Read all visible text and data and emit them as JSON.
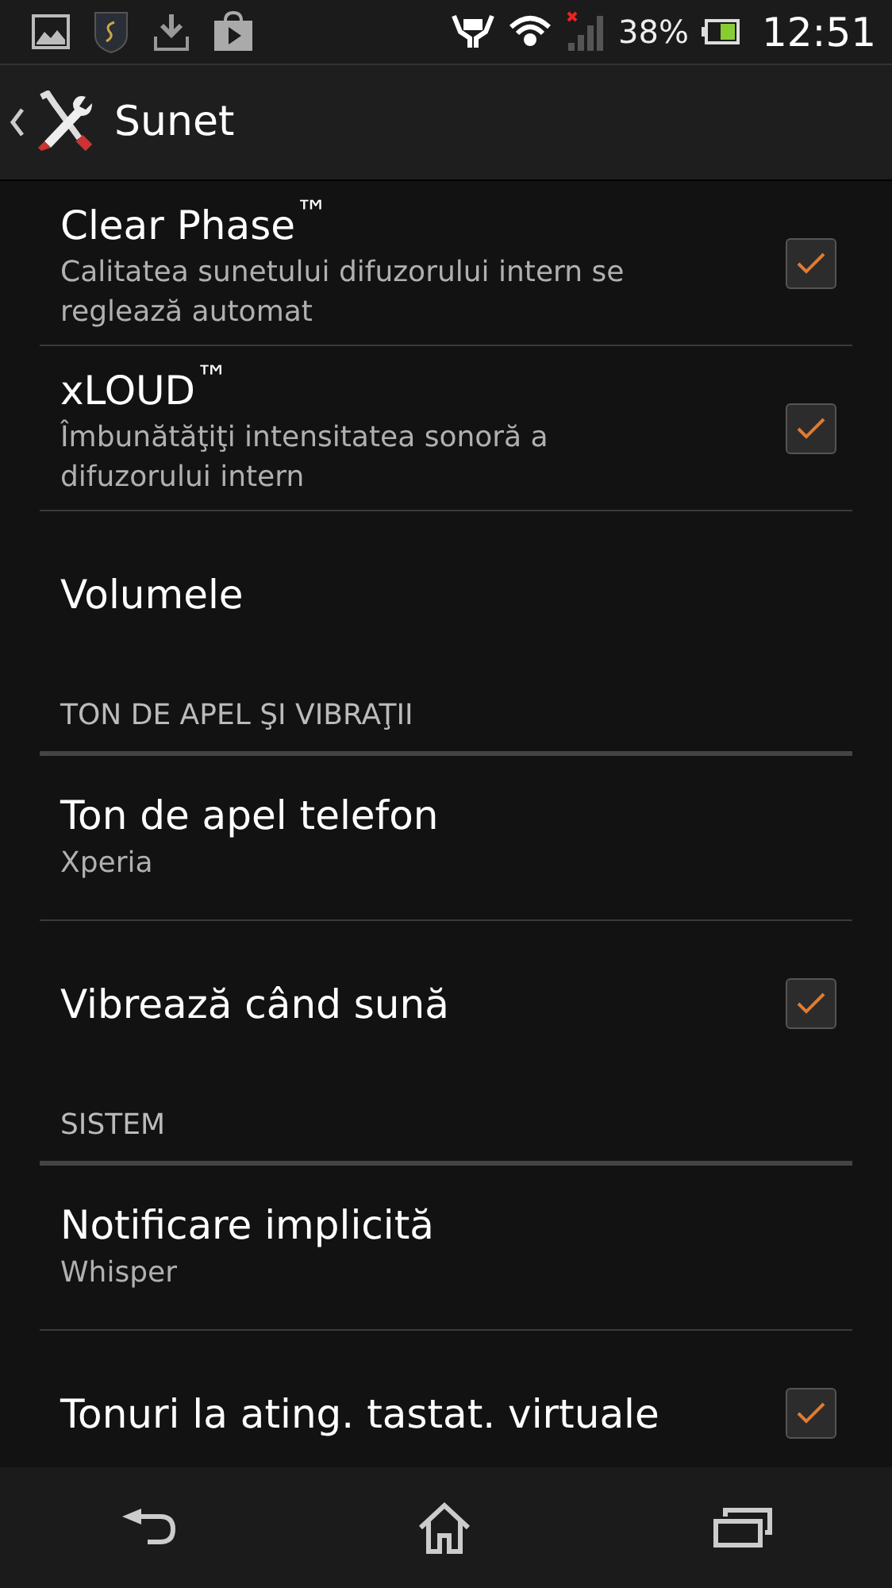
{
  "status_bar": {
    "battery": "38%",
    "time": "12:51"
  },
  "action_bar": {
    "title": "Sunet"
  },
  "items": [
    {
      "kind": "check",
      "title": "Clear Phase$^{™}$",
      "summary": "Calitatea sunetului difuzorului intern se reglează automat",
      "checked": true
    },
    {
      "kind": "check",
      "title": "xLOUD$^{™}$",
      "summary": "Îmbunătăţiţi intensitatea sonoră a difuzorului intern",
      "checked": true
    },
    {
      "kind": "plain",
      "title": "Volumele"
    },
    {
      "kind": "header",
      "title": "TON DE APEL ŞI VIBRAŢII"
    },
    {
      "kind": "plain",
      "title": "Ton de apel telefon",
      "summary": "Xperia"
    },
    {
      "kind": "check",
      "title": "Vibrează când sună",
      "checked": true
    },
    {
      "kind": "header",
      "title": "SISTEM"
    },
    {
      "kind": "plain",
      "title": "Notificare implicită",
      "summary": "Whisper"
    },
    {
      "kind": "check",
      "title": "Tonuri la ating. tastat. virtuale",
      "checked": true
    }
  ]
}
